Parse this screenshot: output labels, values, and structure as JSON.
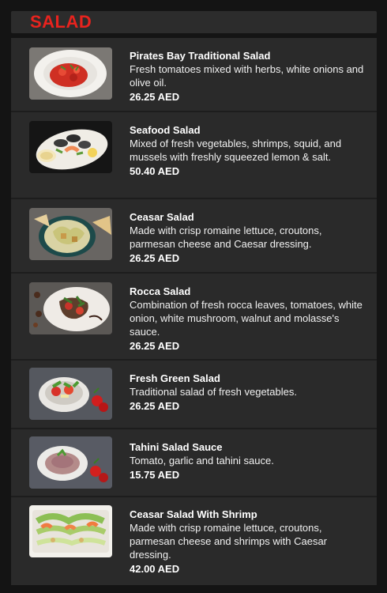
{
  "section": {
    "title": "SALAD"
  },
  "items": [
    {
      "name": "Pirates Bay Traditional Salad",
      "description": "Fresh tomatoes mixed with herbs, white onions and olive oil.",
      "price": "26.25 AED",
      "image_icon": "tomato-salad-plate"
    },
    {
      "name": "Seafood Salad",
      "description": "Mixed of fresh vegetables, shrimps, squid, and mussels with freshly squeezed lemon & salt.",
      "price": "50.40 AED",
      "image_icon": "seafood-plate"
    },
    {
      "name": "Ceasar Salad",
      "description": "Made with crisp romaine lettuce, croutons, parmesan cheese and Caesar dressing.",
      "price": "26.25 AED",
      "image_icon": "caesar-salad-bowl"
    },
    {
      "name": "Rocca Salad",
      "description": "Combination of fresh rocca leaves, tomatoes, white onion, white mushroom, walnut  and molasse's sauce.",
      "price": "26.25 AED",
      "image_icon": "rocca-salad-plate"
    },
    {
      "name": "Fresh Green Salad",
      "description": "Traditional salad of fresh vegetables.",
      "price": "26.25 AED",
      "image_icon": "green-salad-bowl"
    },
    {
      "name": "Tahini Salad Sauce",
      "description": "Tomato, garlic and tahini sauce.",
      "price": "15.75 AED",
      "image_icon": "tahini-bowl"
    },
    {
      "name": "Ceasar Salad With Shrimp",
      "description": "Made with crisp romaine lettuce, croutons, parmesan cheese and shrimps with Caesar dressing.",
      "price": "42.00 AED",
      "image_icon": "caesar-shrimp-platter"
    }
  ]
}
